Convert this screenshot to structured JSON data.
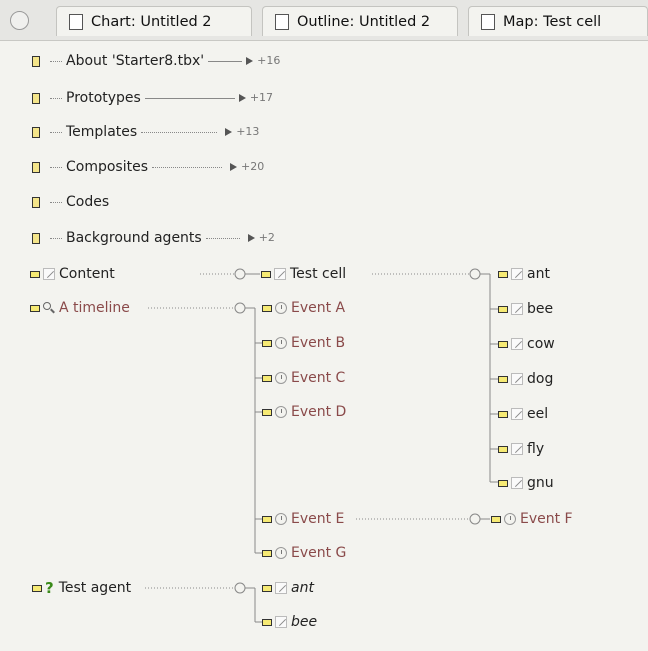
{
  "tabs": [
    {
      "label": "Chart: Untitled 2",
      "icon": "chart-icon"
    },
    {
      "label": "Outline: Untitled 2",
      "icon": "outline-icon"
    },
    {
      "label": "Map: Test cell",
      "icon": "map-icon"
    }
  ],
  "chart": {
    "top_items": [
      {
        "label": "About 'Starter8.tbx'",
        "count": "+16"
      },
      {
        "label": "Prototypes",
        "count": "+17"
      },
      {
        "label": "Templates",
        "count": "+13"
      },
      {
        "label": "Composites",
        "count": "+20"
      },
      {
        "label": "Codes",
        "count": ""
      },
      {
        "label": "Background agents",
        "count": "+2"
      }
    ],
    "content": "Content",
    "test_cell": "Test cell",
    "animals": [
      "ant",
      "bee",
      "cow",
      "dog",
      "eel",
      "fly",
      "gnu"
    ],
    "timeline": "A timeline",
    "events": [
      "Event A",
      "Event B",
      "Event C",
      "Event D",
      "Event E",
      "Event G"
    ],
    "event_f": "Event F",
    "agent": "Test agent",
    "agent_children": [
      "ant",
      "bee"
    ]
  }
}
